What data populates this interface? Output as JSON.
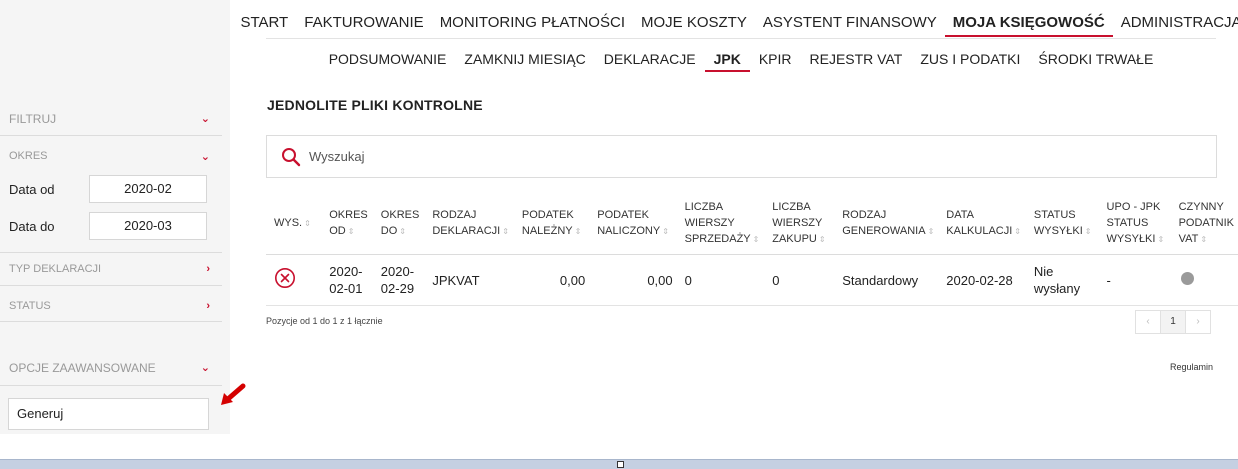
{
  "sidebar": {
    "filter_label": "FILTRUJ",
    "period_label": "OKRES",
    "date_from_label": "Data od",
    "date_from_value": "2020-02",
    "date_to_label": "Data do",
    "date_to_value": "2020-03",
    "declaration_type_label": "TYP DEKLARACJI",
    "status_label": "STATUS",
    "advanced_label": "OPCJE ZAAWANSOWANE",
    "generate_button": "Generuj"
  },
  "nav": {
    "main": [
      "START",
      "FAKTUROWANIE",
      "MONITORING PŁATNOŚCI",
      "MOJE KOSZTY",
      "ASYSTENT FINANSOWY",
      "MOJA KSIĘGOWOŚĆ",
      "ADMINISTRACJA"
    ],
    "main_active": "MOJA KSIĘGOWOŚĆ",
    "sub": [
      "PODSUMOWANIE",
      "ZAMKNIJ MIESIĄC",
      "DEKLARACJE",
      "JPK",
      "KPIR",
      "REJESTR VAT",
      "ZUS I PODATKI",
      "ŚRODKI TRWAŁE"
    ],
    "sub_active": "JPK"
  },
  "page": {
    "title": "JEDNOLITE PLIKI KONTROLNE",
    "search_placeholder": "Wyszukaj"
  },
  "table": {
    "headers": {
      "wys": "WYS.",
      "okres_od": "OKRES OD",
      "okres_do": "OKRES DO",
      "rodzaj": "RODZAJ DEKLARACJI",
      "podatek_nalezny": "PODATEK NALEŻNY",
      "podatek_naliczony": "PODATEK NALICZONY",
      "wiersze_sprzedazy": "LICZBA WIERSZY SPRZEDAŻY",
      "wiersze_zakupu": "LICZBA WIERSZY ZAKUPU",
      "rodzaj_generowania": "RODZAJ GENEROWANIA",
      "data_kalkulacji": "DATA KALKULACJI",
      "status_wysylki": "STATUS WYSYŁKI",
      "upo": "UPO - JPK STATUS WYSYŁKI",
      "czynny": "CZYNNY PODATNIK VAT"
    },
    "rows": [
      {
        "wys_icon": "x-circle-icon",
        "okres_od": "2020-02-01",
        "okres_do": "2020-02-29",
        "rodzaj": "JPKVAT",
        "podatek_nalezny": "0,00",
        "podatek_naliczony": "0,00",
        "wiersze_sprzedazy": "0",
        "wiersze_zakupu": "0",
        "rodzaj_generowania": "Standardowy",
        "data_kalkulacji": "2020-02-28",
        "status_wysylki": "Nie wysłany",
        "upo": "-",
        "czynny_icon": "grey-dot-icon"
      }
    ]
  },
  "footer": {
    "summary": "Pozycje od 1 do 1 z 1 łącznie",
    "pager_prev": "‹",
    "pager_page": "1",
    "pager_next": "›",
    "regulamin": "Regulamin"
  },
  "colors": {
    "accent": "#c8102e",
    "sidebar_bg": "#f5f5f5",
    "muted_text": "#999999"
  }
}
